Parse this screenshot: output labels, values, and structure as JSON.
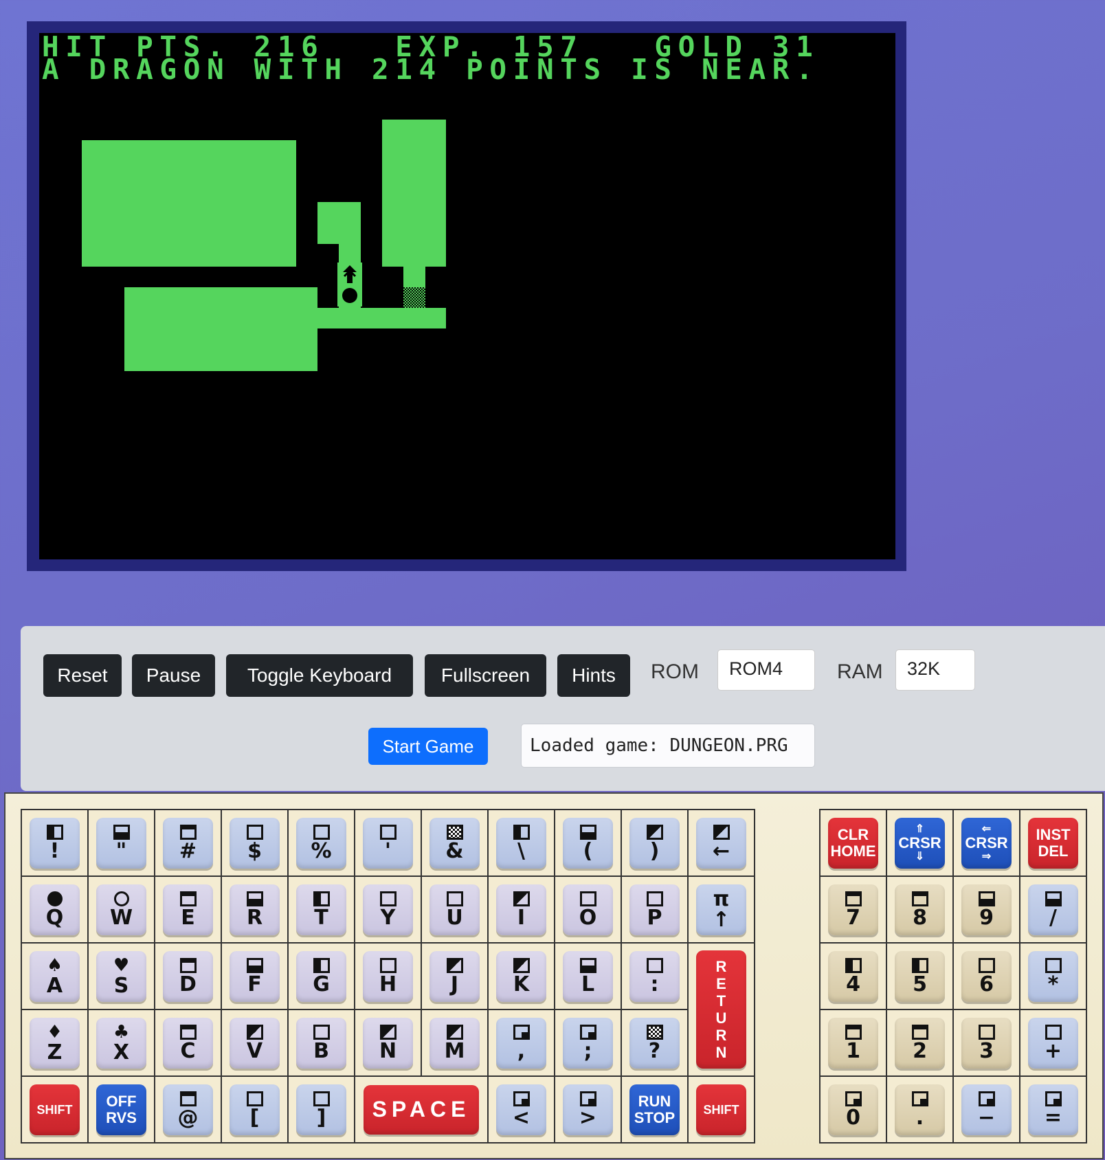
{
  "screen": {
    "line1": "HIT PTS. 216   EXP. 157   GOLD 31",
    "line2": "A DRAGON WITH 214 POINTS IS NEAR.",
    "colors": {
      "phosphor": "#55d55d",
      "background": "#000000",
      "frame": "#25267a"
    }
  },
  "controls": {
    "reset_label": "Reset",
    "pause_label": "Pause",
    "toggle_keyboard_label": "Toggle Keyboard",
    "fullscreen_label": "Fullscreen",
    "hints_label": "Hints",
    "rom_label": "ROM",
    "rom_value": "ROM4",
    "ram_label": "RAM",
    "ram_value": "32K",
    "start_game_label": "Start Game",
    "status_text": "Loaded game: DUNGEON.PRG",
    "accent_color": "#0d6efd"
  },
  "keyboard": {
    "row1": [
      "!",
      "\"",
      "#",
      "$",
      "%",
      "'",
      "&",
      "\\",
      "(",
      ")",
      "←"
    ],
    "row2": [
      "Q",
      "W",
      "E",
      "R",
      "T",
      "Y",
      "U",
      "I",
      "O",
      "P",
      "↑"
    ],
    "row2_pi": "π",
    "row3": [
      "A",
      "S",
      "D",
      "F",
      "G",
      "H",
      "J",
      "K",
      "L",
      ":"
    ],
    "row4": [
      "Z",
      "X",
      "C",
      "V",
      "B",
      "N",
      "M",
      ",",
      ";",
      "?"
    ],
    "row5": {
      "shift_left": "SHIFT",
      "off_rvs": [
        "OFF",
        "RVS"
      ],
      "at": "@",
      "lbracket": "[",
      "rbracket": "]",
      "space": "SPACE",
      "lt": "<",
      "gt": ">",
      "run_stop": [
        "RUN",
        "STOP"
      ],
      "shift_right": "SHIFT"
    },
    "return_label": "RETURN",
    "return_letters": [
      "R",
      "E",
      "T",
      "U",
      "R",
      "N"
    ],
    "suits": {
      "A": "♠",
      "S": "♥",
      "Z": "♦",
      "X": "♣"
    },
    "numpad_top": {
      "clr_home": [
        "CLR",
        "HOME"
      ],
      "crsr_ud": "CRSR",
      "crsr_lr": "CRSR",
      "inst_del": [
        "INST",
        "DEL"
      ]
    },
    "numpad": [
      [
        "7",
        "8",
        "9",
        "/"
      ],
      [
        "4",
        "5",
        "6",
        "*"
      ],
      [
        "1",
        "2",
        "3",
        "+"
      ],
      [
        "0",
        ".",
        "−",
        "="
      ]
    ]
  }
}
